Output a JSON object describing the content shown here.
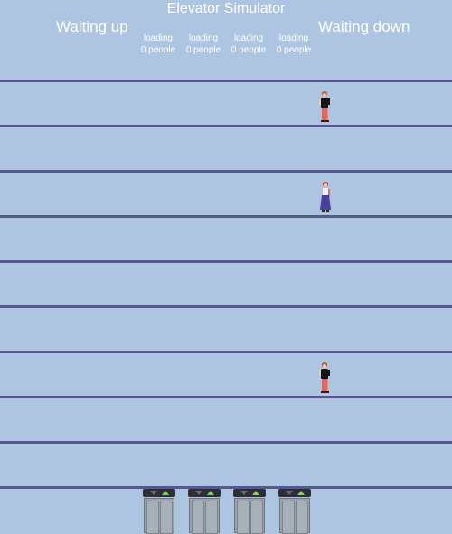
{
  "header": {
    "title": "Elevator Simulator",
    "waiting_up": "Waiting up",
    "waiting_down": "Waiting down"
  },
  "shafts": [
    {
      "status": "loading",
      "people": "0 people"
    },
    {
      "status": "loading",
      "people": "0 people"
    },
    {
      "status": "loading",
      "people": "0 people"
    },
    {
      "status": "loading",
      "people": "0 people"
    }
  ],
  "people": [
    {
      "outfit": "black-top-red-pants"
    },
    {
      "outfit": "purple-dress"
    },
    {
      "outfit": "black-top-red-pants"
    }
  ],
  "colors": {
    "background": "#aec5e1",
    "floor_line": "#56578a",
    "up_arrow": "#8fd14f"
  }
}
